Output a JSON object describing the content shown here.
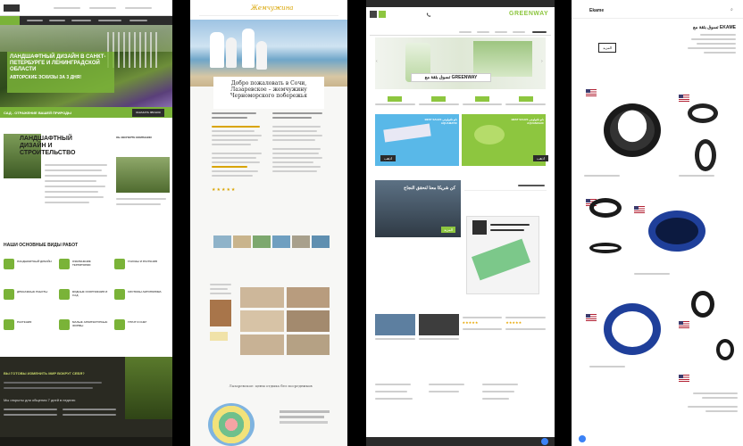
{
  "p1": {
    "hero_title": "ЛАНДШАФТНЫЙ ДИЗАЙН В САНКТ-ПЕТЕРБУРГЕ И ЛЕНИНГРАДСКОЙ ОБЛАСТИ",
    "hero_sub": "АВТОРСКИЕ ЭСКИЗЫ ЗА 3 ДНЯ!",
    "banner": "САД - ОТРАЖЕНИЕ ВАШЕЙ ПРИРОДЫ",
    "banner_btn": "ЗАКАЗАТЬ ЗВОНОК",
    "section_title": "ЛАНДШАФТНЫЙ ДИЗАЙН И СТРОИТЕЛЬСТВО",
    "about_title": "ОБ ЭКСПЕРТЕ КОМПАНИИ",
    "services_title": "НАШИ ОСНОВНЫЕ ВИДЫ РАБОТ",
    "services": [
      "ЛАНДШАФТНЫЙ ДИЗАЙН",
      "ОЗЕЛЕНЕНИЕ ТЕРРИТОРИИ",
      "ГАЗОНЫ И РАСТЕНИЯ",
      "ДРЕНАЖНЫЕ РАБОТЫ",
      "ВОДНЫЕ СООРУЖЕНИЯ И САД",
      "СИСТЕМЫ АВТОПОЛИВА",
      "РАСТЕНИЯ",
      "МАЛЫЕ АРХИТЕКТУРНЫЕ ФОРМЫ",
      "ГРУНТ И СНЕГ"
    ],
    "footer_q": "ВЫ ГОТОВЫ ИЗМЕНИТЬ МИР ВОКРУГ СЕБЯ?",
    "footer_hours": "Мы открыты для общения 7 дней в неделю"
  },
  "p2": {
    "brand": "Жемчужина",
    "hero_title": "Добро пожаловать в Сочи, Лазаревское – жемчужину Черноморского побережья",
    "gallery_title": "Лазаревское: цены отдыха без посредников"
  },
  "p3": {
    "brand": "GREENWAY",
    "banner_text": "تسوق بثقة مع GREENWAY",
    "promo_1": "BEST SALES نانو تكنولوجي AQUAMATIC",
    "promo_2": "BEST SALES نانو تكنولوجي AQUAMAGIC",
    "buy_label": "اذهب",
    "mid_title": "كن شريكا معنا لنحقق النجاح",
    "more_label": "المزيد"
  },
  "p4": {
    "brand": "Ekame",
    "hero_title": "تسوق بثقة مع EKAME",
    "button": "المزيد"
  },
  "colors": {
    "green": "#7ab338",
    "dark": "#1d1d1b",
    "gw_green": "#8dc63f",
    "ring_blue": "#1f3f9a"
  }
}
